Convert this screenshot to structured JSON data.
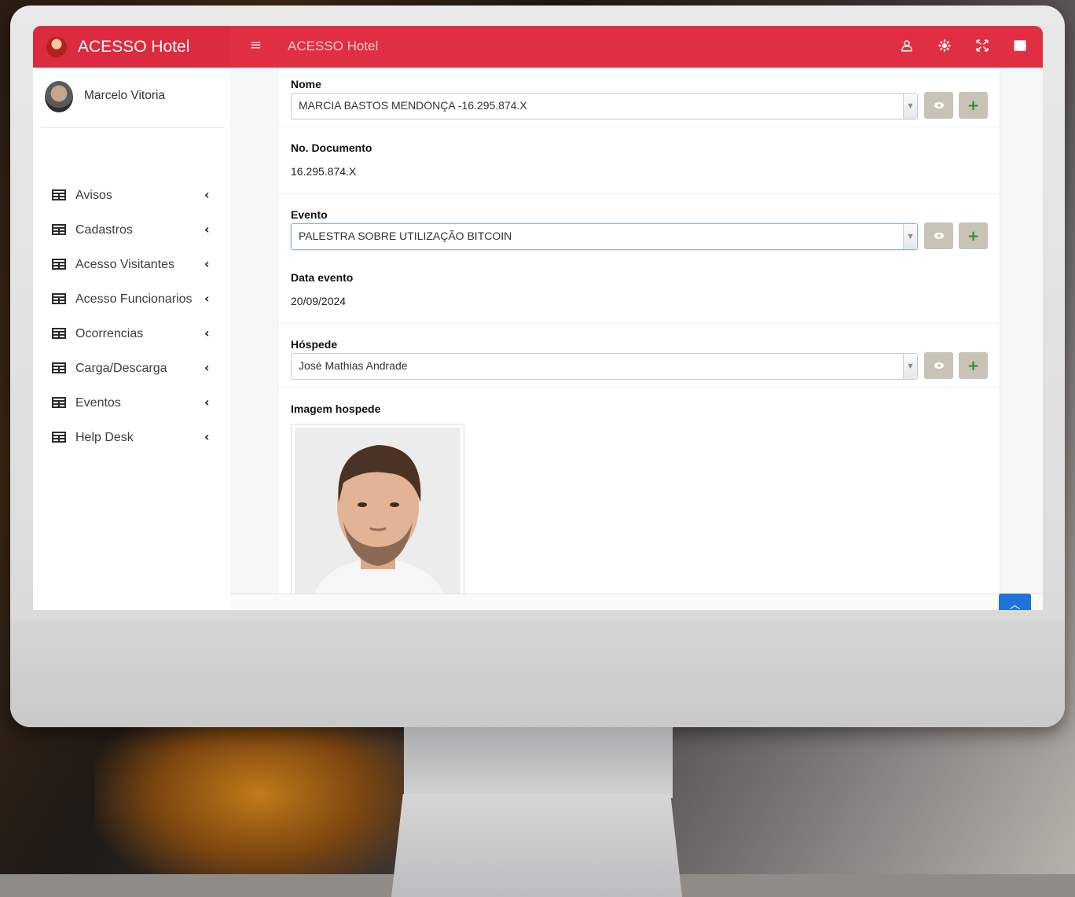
{
  "app": {
    "brand_title": "ACESSO Hotel",
    "top_title": "ACESSO Hotel",
    "accent_color": "#e02f43",
    "top_icons": [
      "user-icon",
      "gear-icon",
      "expand-icon",
      "grid-icon"
    ]
  },
  "user": {
    "name": "Marcelo Vitoria"
  },
  "sidebar": {
    "items": [
      {
        "label": "Avisos",
        "icon": "table-icon"
      },
      {
        "label": "Cadastros",
        "icon": "table-icon"
      },
      {
        "label": "Acesso Visitantes",
        "icon": "table-icon"
      },
      {
        "label": "Acesso Funcionarios",
        "icon": "table-icon"
      },
      {
        "label": "Ocorrencias",
        "icon": "table-icon"
      },
      {
        "label": "Carga/Descarga",
        "icon": "table-icon"
      },
      {
        "label": "Eventos",
        "icon": "table-icon"
      },
      {
        "label": "Help Desk",
        "icon": "table-icon"
      }
    ]
  },
  "form": {
    "nome": {
      "label": "Nome",
      "value": "MARCIA BASTOS MENDONÇA -16.295.874.X"
    },
    "documento": {
      "label": "No. Documento",
      "value": "16.295.874.X"
    },
    "evento": {
      "label": "Evento",
      "value": "PALESTRA SOBRE UTILIZAÇÃO BITCOIN"
    },
    "data_evento": {
      "label": "Data evento",
      "value": "20/09/2024"
    },
    "hospede": {
      "label": "Hóspede",
      "value": "José Mathias Andrade"
    },
    "imagem": {
      "label": "Imagem hospede"
    }
  }
}
